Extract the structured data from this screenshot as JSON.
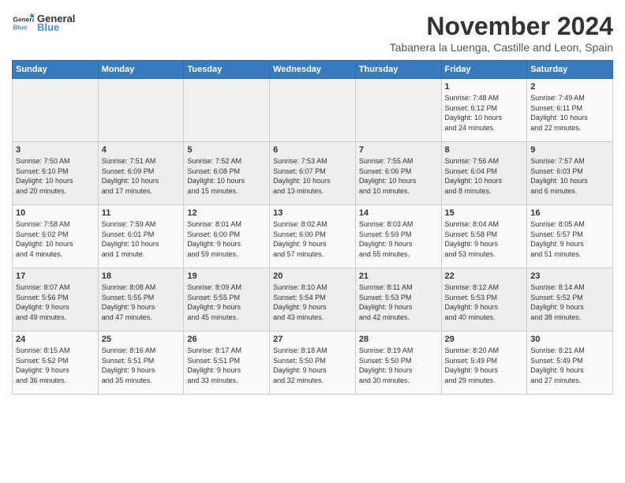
{
  "header": {
    "logo_general": "General",
    "logo_blue": "Blue",
    "month_title": "November 2024",
    "location": "Tabanera la Luenga, Castille and Leon, Spain"
  },
  "weekdays": [
    "Sunday",
    "Monday",
    "Tuesday",
    "Wednesday",
    "Thursday",
    "Friday",
    "Saturday"
  ],
  "weeks": [
    [
      {
        "day": "",
        "info": ""
      },
      {
        "day": "",
        "info": ""
      },
      {
        "day": "",
        "info": ""
      },
      {
        "day": "",
        "info": ""
      },
      {
        "day": "",
        "info": ""
      },
      {
        "day": "1",
        "info": "Sunrise: 7:48 AM\nSunset: 6:12 PM\nDaylight: 10 hours\nand 24 minutes."
      },
      {
        "day": "2",
        "info": "Sunrise: 7:49 AM\nSunset: 6:11 PM\nDaylight: 10 hours\nand 22 minutes."
      }
    ],
    [
      {
        "day": "3",
        "info": "Sunrise: 7:50 AM\nSunset: 6:10 PM\nDaylight: 10 hours\nand 20 minutes."
      },
      {
        "day": "4",
        "info": "Sunrise: 7:51 AM\nSunset: 6:09 PM\nDaylight: 10 hours\nand 17 minutes."
      },
      {
        "day": "5",
        "info": "Sunrise: 7:52 AM\nSunset: 6:08 PM\nDaylight: 10 hours\nand 15 minutes."
      },
      {
        "day": "6",
        "info": "Sunrise: 7:53 AM\nSunset: 6:07 PM\nDaylight: 10 hours\nand 13 minutes."
      },
      {
        "day": "7",
        "info": "Sunrise: 7:55 AM\nSunset: 6:06 PM\nDaylight: 10 hours\nand 10 minutes."
      },
      {
        "day": "8",
        "info": "Sunrise: 7:56 AM\nSunset: 6:04 PM\nDaylight: 10 hours\nand 8 minutes."
      },
      {
        "day": "9",
        "info": "Sunrise: 7:57 AM\nSunset: 6:03 PM\nDaylight: 10 hours\nand 6 minutes."
      }
    ],
    [
      {
        "day": "10",
        "info": "Sunrise: 7:58 AM\nSunset: 6:02 PM\nDaylight: 10 hours\nand 4 minutes."
      },
      {
        "day": "11",
        "info": "Sunrise: 7:59 AM\nSunset: 6:01 PM\nDaylight: 10 hours\nand 1 minute."
      },
      {
        "day": "12",
        "info": "Sunrise: 8:01 AM\nSunset: 6:00 PM\nDaylight: 9 hours\nand 59 minutes."
      },
      {
        "day": "13",
        "info": "Sunrise: 8:02 AM\nSunset: 6:00 PM\nDaylight: 9 hours\nand 57 minutes."
      },
      {
        "day": "14",
        "info": "Sunrise: 8:03 AM\nSunset: 5:59 PM\nDaylight: 9 hours\nand 55 minutes."
      },
      {
        "day": "15",
        "info": "Sunrise: 8:04 AM\nSunset: 5:58 PM\nDaylight: 9 hours\nand 53 minutes."
      },
      {
        "day": "16",
        "info": "Sunrise: 8:05 AM\nSunset: 5:57 PM\nDaylight: 9 hours\nand 51 minutes."
      }
    ],
    [
      {
        "day": "17",
        "info": "Sunrise: 8:07 AM\nSunset: 5:56 PM\nDaylight: 9 hours\nand 49 minutes."
      },
      {
        "day": "18",
        "info": "Sunrise: 8:08 AM\nSunset: 5:55 PM\nDaylight: 9 hours\nand 47 minutes."
      },
      {
        "day": "19",
        "info": "Sunrise: 8:09 AM\nSunset: 5:55 PM\nDaylight: 9 hours\nand 45 minutes."
      },
      {
        "day": "20",
        "info": "Sunrise: 8:10 AM\nSunset: 5:54 PM\nDaylight: 9 hours\nand 43 minutes."
      },
      {
        "day": "21",
        "info": "Sunrise: 8:11 AM\nSunset: 5:53 PM\nDaylight: 9 hours\nand 42 minutes."
      },
      {
        "day": "22",
        "info": "Sunrise: 8:12 AM\nSunset: 5:53 PM\nDaylight: 9 hours\nand 40 minutes."
      },
      {
        "day": "23",
        "info": "Sunrise: 8:14 AM\nSunset: 5:52 PM\nDaylight: 9 hours\nand 38 minutes."
      }
    ],
    [
      {
        "day": "24",
        "info": "Sunrise: 8:15 AM\nSunset: 5:52 PM\nDaylight: 9 hours\nand 36 minutes."
      },
      {
        "day": "25",
        "info": "Sunrise: 8:16 AM\nSunset: 5:51 PM\nDaylight: 9 hours\nand 35 minutes."
      },
      {
        "day": "26",
        "info": "Sunrise: 8:17 AM\nSunset: 5:51 PM\nDaylight: 9 hours\nand 33 minutes."
      },
      {
        "day": "27",
        "info": "Sunrise: 8:18 AM\nSunset: 5:50 PM\nDaylight: 9 hours\nand 32 minutes."
      },
      {
        "day": "28",
        "info": "Sunrise: 8:19 AM\nSunset: 5:50 PM\nDaylight: 9 hours\nand 30 minutes."
      },
      {
        "day": "29",
        "info": "Sunrise: 8:20 AM\nSunset: 5:49 PM\nDaylight: 9 hours\nand 29 minutes."
      },
      {
        "day": "30",
        "info": "Sunrise: 8:21 AM\nSunset: 5:49 PM\nDaylight: 9 hours\nand 27 minutes."
      }
    ]
  ]
}
